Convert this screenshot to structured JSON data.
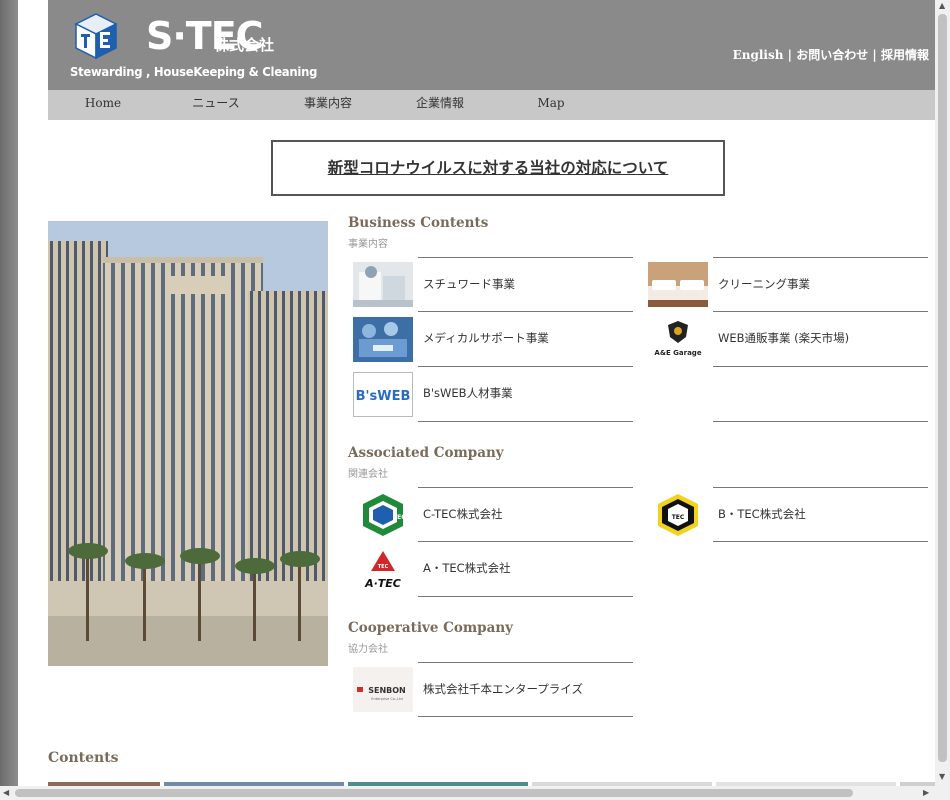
{
  "header": {
    "logo_company": "S·TEC",
    "logo_suffix": "株式会社",
    "logo_tagline": "Stewarding , HouseKeeping & Cleaning",
    "top_links": [
      {
        "label": "English"
      },
      {
        "label": "お問い合わせ"
      },
      {
        "label": "採用情報"
      }
    ],
    "separator": "|"
  },
  "nav": {
    "items": [
      {
        "label": "Home"
      },
      {
        "label": "ニュース"
      },
      {
        "label": "事業内容"
      },
      {
        "label": "企業情報"
      },
      {
        "label": "Map"
      }
    ]
  },
  "notice": {
    "label": "新型コロナウイルスに対する当社の対応について"
  },
  "business": {
    "title": "Business Contents",
    "subtitle": "事業内容",
    "items": [
      {
        "label": "スチュワード事業"
      },
      {
        "label": "クリーニング事業"
      },
      {
        "label": "メディカルサポート事業"
      },
      {
        "label": "WEB通販事業 (楽天市場)"
      },
      {
        "label": "B'sWEB人材事業"
      },
      {
        "label": ""
      }
    ]
  },
  "associated": {
    "title": "Associated Company",
    "subtitle": "関連会社",
    "items": [
      {
        "label": "C-TEC株式会社"
      },
      {
        "label": "B・TEC株式会社"
      },
      {
        "label": "A・TEC株式会社"
      }
    ]
  },
  "cooperative": {
    "title": "Cooperative Company",
    "subtitle": "協力会社",
    "items": [
      {
        "label": "株式会社千本エンタープライズ"
      }
    ]
  },
  "contents": {
    "title": "Contents"
  },
  "logos": {
    "bsweb": "B'sWEB",
    "ae_garage": "A&E Garage",
    "ctec": "TEC",
    "btec": "TEC",
    "atec": "A·TEC",
    "atec_small": "TEC",
    "senbon": "SENBON",
    "senbon_sub": "Enterprise Co.,Ltd"
  },
  "colors": {
    "header_bg": "#8a8a8a",
    "nav_bg": "#c8c8c8",
    "section_title": "#7a6a5a",
    "logo_blue": "#1e5fb0"
  }
}
